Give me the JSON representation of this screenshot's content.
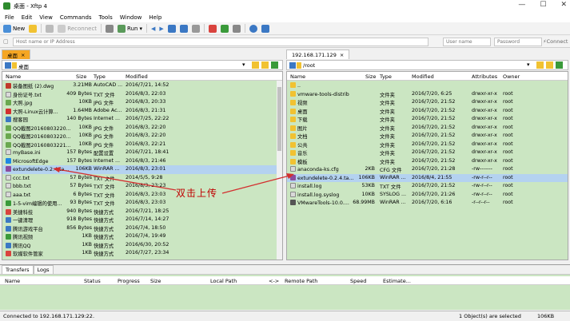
{
  "window": {
    "title": "桌面 - Xftp 4",
    "btn_min": "—",
    "btn_max": "☐",
    "btn_close": "✕"
  },
  "menu": [
    "File",
    "Edit",
    "View",
    "Commands",
    "Tools",
    "Window",
    "Help"
  ],
  "toolbar": {
    "new_label": "New",
    "reconnect_label": "Reconnect",
    "run_label": "Run",
    "connect_label": "Connect"
  },
  "address": {
    "host_placeholder": "Host name or IP Address",
    "user_placeholder": "User name",
    "pass_placeholder": "Password"
  },
  "local": {
    "tab": "桌面",
    "path": "桌面",
    "columns": [
      "Name",
      "Size",
      "Type",
      "Modified"
    ],
    "files": [
      {
        "name": "装备图纸 (2).dwg",
        "size": "3.21MB",
        "type": "AutoCAD ...",
        "modified": "2016/7/21, 14:52",
        "icon": "cad"
      },
      {
        "name": "身份证号.txt",
        "size": "409 Bytes",
        "type": "TXT 文件",
        "modified": "2016/8/3, 22:03",
        "icon": "doc"
      },
      {
        "name": "大照.jpg",
        "size": "10KB",
        "type": "JPG 文件",
        "modified": "2016/8/3, 20:33",
        "icon": "jpg"
      },
      {
        "name": "大照-Linux云计算...",
        "size": "1.64MB",
        "type": "Adobe Ac...",
        "modified": "2016/8/3, 21:31",
        "icon": "pdf"
      },
      {
        "name": "搜客园",
        "size": "140 Bytes",
        "type": "Internet ...",
        "modified": "2016/7/25, 22:22",
        "icon": "blu"
      },
      {
        "name": "QQ截图20160803220...",
        "size": "10KB",
        "type": "JPG 文件",
        "modified": "2016/8/3, 22:20",
        "icon": "jpg"
      },
      {
        "name": "QQ截图20160803220...",
        "size": "10KB",
        "type": "JPG 文件",
        "modified": "2016/8/3, 22:20",
        "icon": "jpg"
      },
      {
        "name": "QQ截图20160803221...",
        "size": "10KB",
        "type": "JPG 文件",
        "modified": "2016/8/3, 22:21",
        "icon": "jpg"
      },
      {
        "name": "myBase.ini",
        "size": "157 Bytes",
        "type": "配置设置",
        "modified": "2016/7/21, 18:41",
        "icon": "doc"
      },
      {
        "name": "MicrosoftEdge",
        "size": "157 Bytes",
        "type": "Internet ...",
        "modified": "2016/8/3, 21:46",
        "icon": "edge"
      },
      {
        "name": "extundelete-0.2.4.ta...",
        "size": "106KB",
        "type": "WinRAR ...",
        "modified": "2016/8/3, 23:01",
        "icon": "rar"
      },
      {
        "name": "ccc.txt",
        "size": "57 Bytes",
        "type": "TXT 文件",
        "modified": "2014/5/5, 9:28",
        "icon": "doc"
      },
      {
        "name": "bbb.txt",
        "size": "57 Bytes",
        "type": "TXT 文件",
        "modified": "2016/8/3, 23:23",
        "icon": "doc"
      },
      {
        "name": "aaa.txt",
        "size": "6 Bytes",
        "type": "TXT 文件",
        "modified": "2016/8/3, 23:03",
        "icon": "doc"
      },
      {
        "name": "1-5-vim编辑的使用...",
        "size": "93 Bytes",
        "type": "TXT 文件",
        "modified": "2016/8/3, 23:03",
        "icon": "grn"
      },
      {
        "name": "美捷科技",
        "size": "940 Bytes",
        "type": "快捷方式",
        "modified": "2016/7/21, 18:25",
        "icon": "red"
      },
      {
        "name": "一键清理",
        "size": "918 Bytes",
        "type": "快捷方式",
        "modified": "2016/7/14, 14:27",
        "icon": "blu"
      },
      {
        "name": "腾讯游戏平台",
        "size": "856 Bytes",
        "type": "快捷方式",
        "modified": "2016/7/4, 18:50",
        "icon": "blu"
      },
      {
        "name": "腾讯视频",
        "size": "1KB",
        "type": "快捷方式",
        "modified": "2016/7/4, 19:49",
        "icon": "grn"
      },
      {
        "name": "腾讯QQ",
        "size": "1KB",
        "type": "快捷方式",
        "modified": "2016/6/30, 20:52",
        "icon": "blu"
      },
      {
        "name": "软媒软件管家",
        "size": "1KB",
        "type": "快捷方式",
        "modified": "2016/7/27, 23:34",
        "icon": "red"
      }
    ]
  },
  "remote": {
    "tab": "192.168.171.129",
    "path": "/root",
    "columns": [
      "Name",
      "Size",
      "Type",
      "Modified",
      "Attributes",
      "Owner"
    ],
    "files": [
      {
        "name": "..",
        "size": "",
        "type": "",
        "modified": "",
        "attr": "",
        "owner": "",
        "icon": "fold"
      },
      {
        "name": "vmware-tools-distrib",
        "size": "",
        "type": "文件夹",
        "modified": "2016/7/20, 6:25",
        "attr": "drwxr-xr-x",
        "owner": "root",
        "icon": "fold"
      },
      {
        "name": "视频",
        "size": "",
        "type": "文件夹",
        "modified": "2016/7/20, 21:52",
        "attr": "drwxr-xr-x",
        "owner": "root",
        "icon": "fold"
      },
      {
        "name": "桌面",
        "size": "",
        "type": "文件夹",
        "modified": "2016/7/20, 21:52",
        "attr": "drwxr-xr-x",
        "owner": "root",
        "icon": "fold"
      },
      {
        "name": "下载",
        "size": "",
        "type": "文件夹",
        "modified": "2016/7/20, 21:52",
        "attr": "drwxr-xr-x",
        "owner": "root",
        "icon": "fold"
      },
      {
        "name": "图片",
        "size": "",
        "type": "文件夹",
        "modified": "2016/7/20, 21:52",
        "attr": "drwxr-xr-x",
        "owner": "root",
        "icon": "fold"
      },
      {
        "name": "文档",
        "size": "",
        "type": "文件夹",
        "modified": "2016/7/20, 21:52",
        "attr": "drwxr-xr-x",
        "owner": "root",
        "icon": "fold"
      },
      {
        "name": "公共",
        "size": "",
        "type": "文件夹",
        "modified": "2016/7/20, 21:52",
        "attr": "drwxr-xr-x",
        "owner": "root",
        "icon": "fold"
      },
      {
        "name": "音乐",
        "size": "",
        "type": "文件夹",
        "modified": "2016/7/20, 21:52",
        "attr": "drwxr-xr-x",
        "owner": "root",
        "icon": "fold"
      },
      {
        "name": "模板",
        "size": "",
        "type": "文件夹",
        "modified": "2016/7/20, 21:52",
        "attr": "drwxr-xr-x",
        "owner": "root",
        "icon": "fold"
      },
      {
        "name": "anaconda-ks.cfg",
        "size": "2KB",
        "type": "CFG 文件",
        "modified": "2016/7/20, 21:28",
        "attr": "-rw-------",
        "owner": "root",
        "icon": "doc"
      },
      {
        "name": "extundelete-0.2.4.ta...",
        "size": "106KB",
        "type": "WinRAR ...",
        "modified": "2016/8/4, 21:55",
        "attr": "-rw-r--r--",
        "owner": "root",
        "icon": "rar"
      },
      {
        "name": "install.log",
        "size": "53KB",
        "type": "TXT 文件",
        "modified": "2016/7/20, 21:52",
        "attr": "-rw-r--r--",
        "owner": "root",
        "icon": "doc"
      },
      {
        "name": "install.log.syslog",
        "size": "10KB",
        "type": "SYSLOG ...",
        "modified": "2016/7/20, 21:26",
        "attr": "-rw-r--r--",
        "owner": "root",
        "icon": "doc"
      },
      {
        "name": "VMwareTools-10.0....",
        "size": "68.99MB",
        "type": "WinRAR ...",
        "modified": "2016/7/20, 6:16",
        "attr": "-r--r--r--",
        "owner": "root",
        "icon": "vm"
      }
    ]
  },
  "annotation": "双击上传",
  "transfers": {
    "tabs": [
      "Transfers",
      "Logs"
    ],
    "columns": [
      "Name",
      "Status",
      "Progress",
      "Size",
      "Local Path",
      "<->",
      "Remote Path",
      "Speed",
      "Estimate..."
    ]
  },
  "status": {
    "left": "Connected to 192.168.171.129:22.",
    "objects": "1 Object(s) are selected",
    "size": "106KB"
  }
}
